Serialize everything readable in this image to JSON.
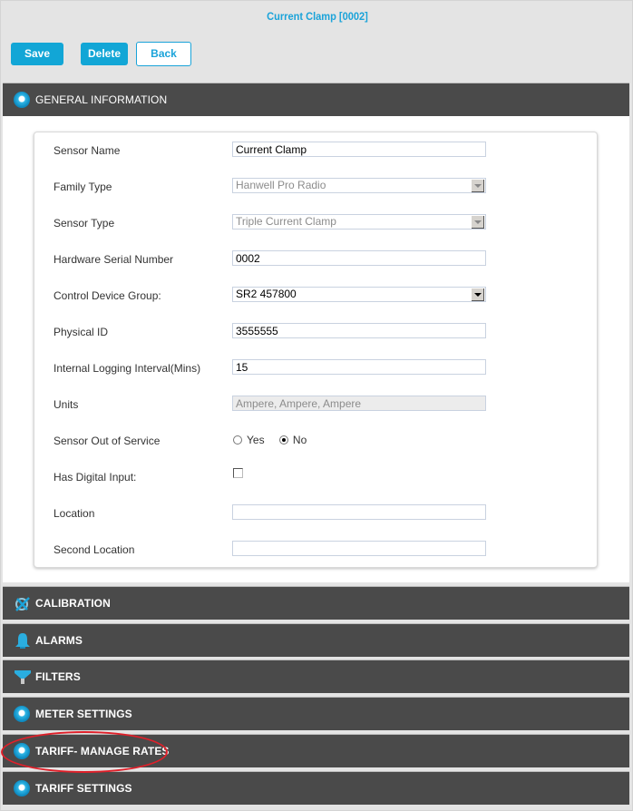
{
  "header": {
    "title": "Current Clamp [0002]"
  },
  "toolbar": {
    "save_label": "Save",
    "delete_label": "Delete",
    "back_label": "Back"
  },
  "colors": {
    "accent": "#12a6d6",
    "section_bg": "#4a4a4a",
    "page_bg": "#e4e4e4",
    "highlight": "#e0202a"
  },
  "sections": [
    {
      "label": "GENERAL INFORMATION",
      "icon": "bullet-icon",
      "expanded": true
    },
    {
      "label": "CALIBRATION",
      "icon": "calibration-icon"
    },
    {
      "label": "ALARMS",
      "icon": "bell-icon"
    },
    {
      "label": "FILTERS",
      "icon": "filter-icon"
    },
    {
      "label": "METER SETTINGS",
      "icon": "bullet-icon"
    },
    {
      "label": "TARIFF- MANAGE RATES",
      "icon": "bullet-icon",
      "highlighted": true
    },
    {
      "label": "TARIFF SETTINGS",
      "icon": "bullet-icon"
    }
  ],
  "form": {
    "sensor_name": {
      "label": "Sensor Name",
      "value": "Current Clamp"
    },
    "family_type": {
      "label": "Family Type",
      "value": "Hanwell Pro Radio"
    },
    "sensor_type": {
      "label": "Sensor Type",
      "value": "Triple Current Clamp"
    },
    "hardware_serial": {
      "label": "Hardware Serial Number",
      "value": "0002"
    },
    "control_device_group": {
      "label": "Control Device Group:",
      "value": "SR2 457800"
    },
    "physical_id": {
      "label": "Physical ID",
      "value": "3555555"
    },
    "logging_interval": {
      "label": "Internal Logging Interval(Mins)",
      "value": "15"
    },
    "units": {
      "label": "Units",
      "value": "Ampere, Ampere, Ampere"
    },
    "out_of_service": {
      "label": "Sensor Out of Service",
      "options": [
        "Yes",
        "No"
      ],
      "selected": "No"
    },
    "digital_input": {
      "label": "Has Digital Input:",
      "checked": false
    },
    "location": {
      "label": "Location",
      "value": ""
    },
    "second_location": {
      "label": "Second Location",
      "value": ""
    }
  }
}
